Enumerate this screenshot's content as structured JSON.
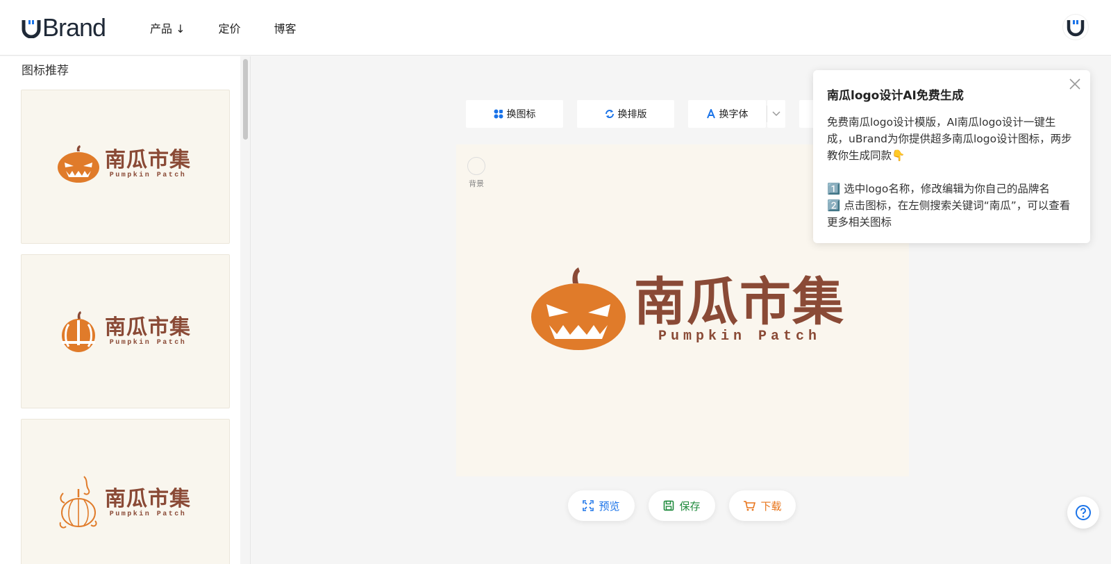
{
  "header": {
    "brand_name": "Brand",
    "nav": [
      {
        "label": "产品 ↓"
      },
      {
        "label": "定价"
      },
      {
        "label": "博客"
      }
    ]
  },
  "sidebar": {
    "title": "图标推荐",
    "cards": [
      {
        "name_cn": "南瓜市集",
        "name_en": "Pumpkin Patch",
        "icon": "jack-o-lantern-icon"
      },
      {
        "name_cn": "南瓜市集",
        "name_en": "Pumpkin Patch",
        "icon": "pumpkin-circle-icon"
      },
      {
        "name_cn": "南瓜市集",
        "name_en": "Pumpkin Patch",
        "icon": "pumpkin-vine-icon"
      }
    ]
  },
  "toolbar": {
    "change_icon": "换图标",
    "change_layout": "换排版",
    "change_font": "换字体"
  },
  "canvas": {
    "bg_label": "背景",
    "logo_cn": "南瓜市集",
    "logo_en": "Pumpkin Patch",
    "bg_color": "#faf6ee",
    "text_color": "#8a4a36",
    "icon_color": "#e07b2a"
  },
  "actions": {
    "preview": "预览",
    "save": "保存",
    "download": "下载"
  },
  "popup": {
    "title": "南瓜logo设计AI免费生成",
    "intro": "免费南瓜logo设计模版，AI南瓜logo设计一键生成，uBrand为你提供超多南瓜logo设计图标，两步教你生成同款👇",
    "step1": "1️⃣ 选中logo名称，修改编辑为你自己的品牌名",
    "step2": "2️⃣ 点击图标，在左侧搜索关键词“南瓜”，可以查看更多相关图标"
  }
}
